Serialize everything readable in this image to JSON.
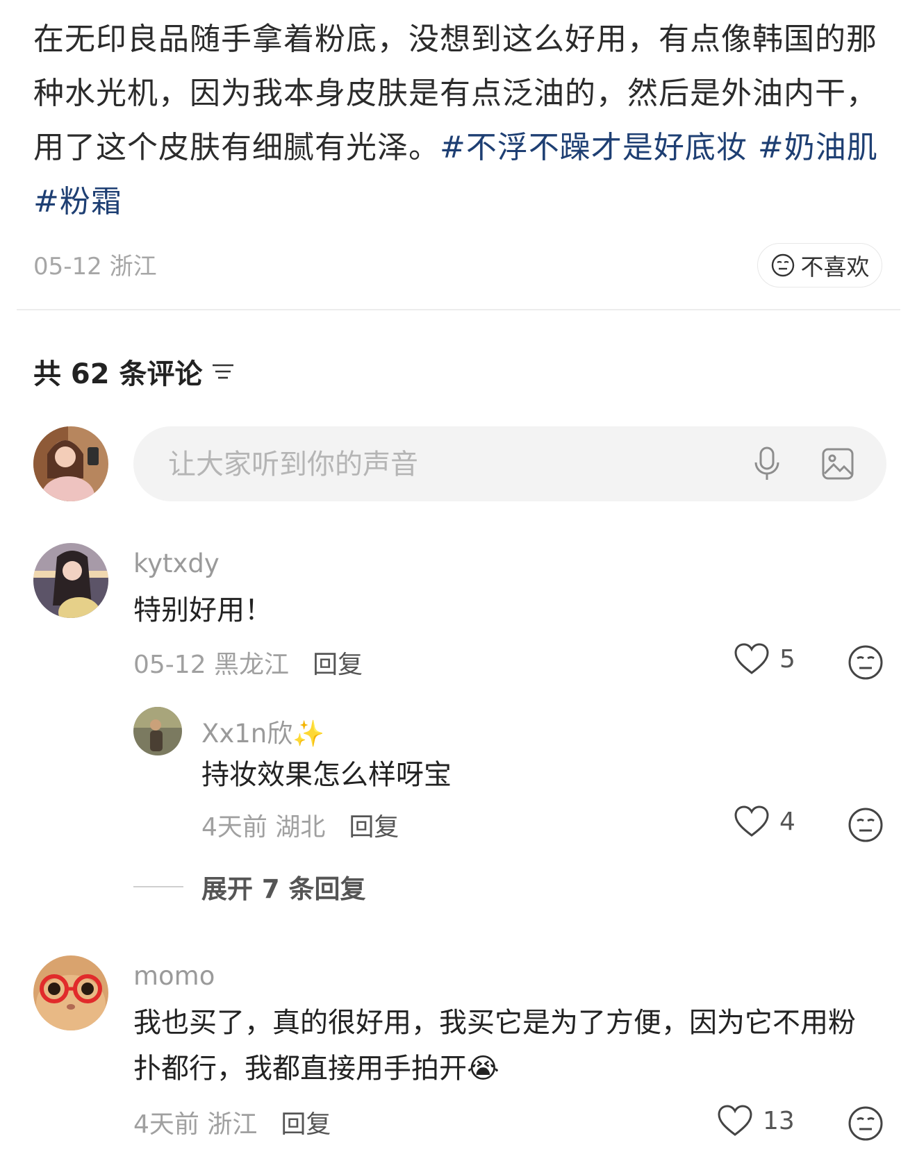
{
  "post": {
    "body_text": "在无印良品随手拿着粉底，没想到这么好用，有点像韩国的那种水光机，因为我本身皮肤是有点泛油的，然后是外油内干，用了这个皮肤有细腻有光泽。",
    "hashtags": [
      "#不浮不躁才是好底妆",
      "#奶油肌",
      "#粉霜"
    ],
    "date_location": "05-12 浙江",
    "dislike_label": "不喜欢"
  },
  "comments_header": {
    "label": "共 62 条评论",
    "sort_icon": "sort-lines-icon"
  },
  "comment_input": {
    "placeholder": "让大家听到你的声音",
    "mic_icon": "microphone-icon",
    "image_icon": "image-icon"
  },
  "comments": [
    {
      "username": "kytxdy",
      "text": "特别好用！",
      "date_location": "05-12 黑龙江",
      "reply_label": "回复",
      "likes": "5",
      "replies": [
        {
          "username": "Xx1n欣✨",
          "text": "持妆效果怎么样呀宝",
          "date_location": "4天前 湖北",
          "reply_label": "回复",
          "likes": "4"
        }
      ],
      "expand_label": "展开 7 条回复"
    },
    {
      "username": "momo",
      "text": "我也买了，真的很好用，我买它是为了方便，因为它不用粉扑都行，我都直接用手拍开😭",
      "date_location": "4天前 浙江",
      "reply_label": "回复",
      "likes": "13"
    }
  ],
  "colors": {
    "hashtag": "#1e3f73",
    "meta_gray": "#a0a0a0",
    "input_bg": "#f3f3f3"
  }
}
